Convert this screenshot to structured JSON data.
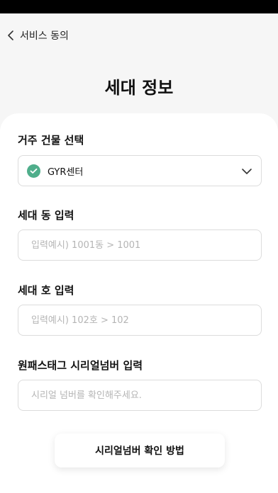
{
  "header": {
    "back_label": "서비스 동의",
    "title": "세대 정보"
  },
  "form": {
    "building": {
      "label": "거주 건물 선택",
      "value": "GYR센터"
    },
    "dong": {
      "label": "세대 동 입력",
      "placeholder": "입력예시) 1001동 > 1001",
      "value": ""
    },
    "ho": {
      "label": "세대 호 입력",
      "placeholder": "입력예시) 102호 > 102",
      "value": ""
    },
    "serial": {
      "label": "원패스태그 시리얼넘버 입력",
      "placeholder": "시리얼 넘버를 확인해주세요.",
      "value": ""
    }
  },
  "footer": {
    "help_button_label": "시리얼넘버 확인 방법"
  },
  "colors": {
    "accent": "#4fae8b",
    "background": "#f6f6f6",
    "border": "#dcdcdc"
  },
  "icons": {
    "back": "chevron-left-icon",
    "selected": "check-circle-icon",
    "dropdown": "chevron-down-icon"
  }
}
